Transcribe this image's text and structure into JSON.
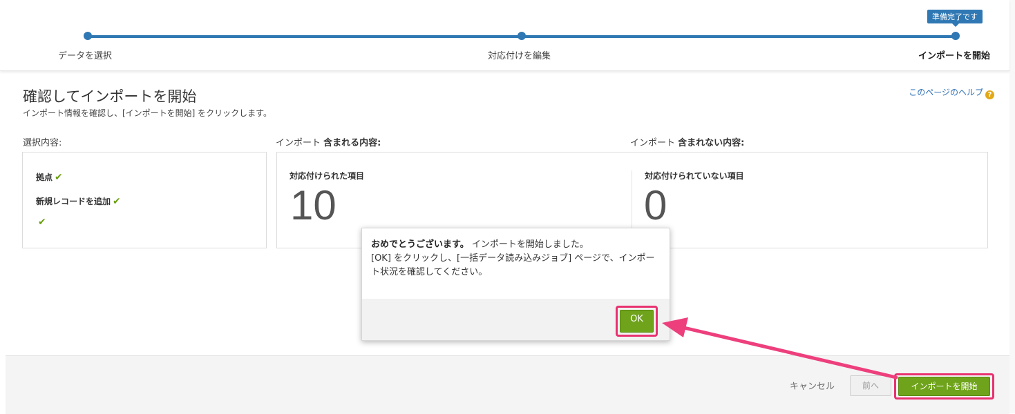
{
  "stepper": {
    "badge": "準備完了です",
    "steps": [
      "データを選択",
      "対応付けを編集",
      "インポートを開始"
    ]
  },
  "header": {
    "title": "確認してインポートを開始",
    "subtitle": "インポート情報を確認し、[インポートを開始] をクリックします。",
    "help_link": "このページのヘルプ",
    "help_icon": "?"
  },
  "selection": {
    "heading": "選択内容:",
    "items": [
      "拠点",
      "新規レコードを追加",
      ""
    ]
  },
  "included": {
    "heading_prefix": "インポート",
    "heading_bold": "含まれる内容:",
    "label": "対応付けられた項目",
    "count": "10"
  },
  "excluded": {
    "heading_prefix": "インポート",
    "heading_bold": "含まれない内容:",
    "label": "対応付けられていない項目",
    "count": "0"
  },
  "dialog": {
    "bold": "おめでとうございます。",
    "line1": "インポートを開始しました。",
    "line2": "[OK] をクリックし、[一括データ読み込みジョブ] ページで、インポート状況を確認してください。",
    "ok_label": "OK"
  },
  "footer": {
    "cancel": "キャンセル",
    "prev": "前へ",
    "start": "インポートを開始"
  },
  "colors": {
    "accent": "#2f78b4",
    "green": "#6fa31b",
    "highlight": "#e8316f"
  },
  "icons": [
    "checkmark-icon",
    "help-icon",
    "arrow-annotation"
  ]
}
